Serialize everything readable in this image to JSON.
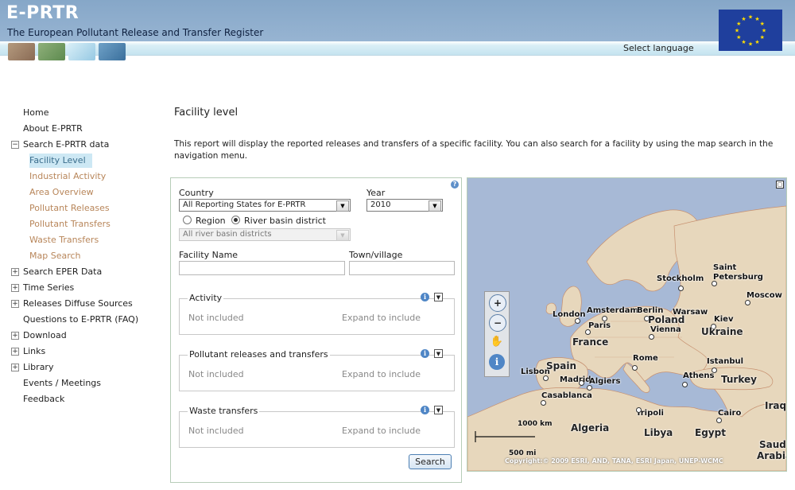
{
  "header": {
    "title": "E-PRTR",
    "subtitle": "The European Pollutant Release and Transfer Register",
    "select_language": "Select language"
  },
  "nav": {
    "home": "Home",
    "about": "About E-PRTR",
    "search_data": "Search E-PRTR data",
    "sub": {
      "facility_level": "Facility Level",
      "industrial_activity": "Industrial Activity",
      "area_overview": "Area Overview",
      "pollutant_releases": "Pollutant Releases",
      "pollutant_transfers": "Pollutant Transfers",
      "waste_transfers": "Waste Transfers",
      "map_search": "Map Search"
    },
    "search_eper": "Search EPER Data",
    "time_series": "Time Series",
    "diffuse_sources": "Releases Diffuse Sources",
    "faq": "Questions to E-PRTR (FAQ)",
    "download": "Download",
    "links": "Links",
    "library": "Library",
    "events": "Events / Meetings",
    "feedback": "Feedback"
  },
  "main": {
    "title": "Facility level",
    "intro": "This report will display the reported releases and transfers of a specific facility. You can also search for a facility by using the map search in the navigation menu."
  },
  "form": {
    "country_label": "Country",
    "country_value": "All Reporting States for E-PRTR",
    "year_label": "Year",
    "year_value": "2010",
    "region_label": "Region",
    "river_basin_label": "River basin district",
    "river_basin_value": "All river basin districts",
    "facility_name_label": "Facility Name",
    "town_label": "Town/village",
    "activity_title": "Activity",
    "pollutant_title": "Pollutant releases and transfers",
    "waste_title": "Waste transfers",
    "not_included": "Not included",
    "expand": "Expand to include",
    "search_button": "Search"
  },
  "map": {
    "cities": {
      "stockholm": "Stockholm",
      "saint_petersburg_1": "Saint",
      "saint_petersburg_2": "Petersburg",
      "moscow": "Moscow",
      "amsterdam": "Amsterdam",
      "berlin": "Berlin",
      "warsaw": "Warsaw",
      "london": "London",
      "paris": "Paris",
      "vienna": "Vienna",
      "kiev": "Kiev",
      "rome": "Rome",
      "madrid": "Madrid",
      "lisbon": "Lisbon",
      "algiers": "Algiers",
      "istanbul": "Istanbul",
      "athens": "Athens",
      "casablanca": "Casablanca",
      "tripoli": "Tripoli",
      "cairo": "Cairo"
    },
    "countries": {
      "poland": "Poland",
      "ukraine": "Ukraine",
      "france": "France",
      "spain": "Spain",
      "turkey": "Turkey",
      "algeria": "Algeria",
      "libya": "Libya",
      "egypt": "Egypt",
      "iraq": "Iraq",
      "saudi_1": "Saudi",
      "saudi_2": "Arabia"
    },
    "scale_km": "1000 km",
    "scale_mi": "500 mi",
    "copyright": "Copyright:© 2009 ESRI, AND, TANA, ESRI Japan, UNEP-WCMC"
  }
}
